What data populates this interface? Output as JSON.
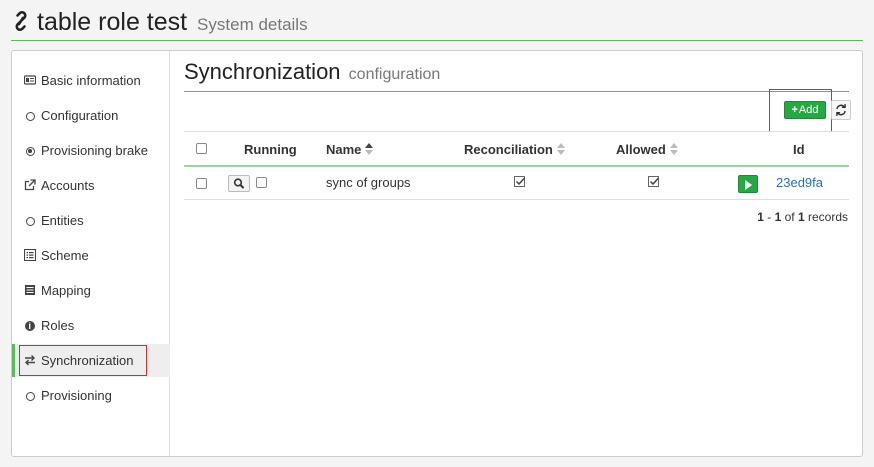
{
  "header": {
    "title": "table role test",
    "subtitle": "System details",
    "icon": "link-icon"
  },
  "sidebar": {
    "items": [
      {
        "label": "Basic information",
        "icon": "id-card-icon"
      },
      {
        "label": "Configuration",
        "icon": "circle-icon"
      },
      {
        "label": "Provisioning brake",
        "icon": "dot-circle-icon"
      },
      {
        "label": "Accounts",
        "icon": "external-link-icon"
      },
      {
        "label": "Entities",
        "icon": "circle-icon"
      },
      {
        "label": "Scheme",
        "icon": "list-alt-icon"
      },
      {
        "label": "Mapping",
        "icon": "list-icon"
      },
      {
        "label": "Roles",
        "icon": "info-icon"
      },
      {
        "label": "Synchronization",
        "icon": "exchange-icon",
        "active": true
      },
      {
        "label": "Provisioning",
        "icon": "circle-icon"
      }
    ]
  },
  "main": {
    "title": "Synchronization",
    "subtitle": "configuration",
    "toolbar": {
      "add_label": "Add",
      "refresh_icon": "refresh-icon"
    },
    "table": {
      "columns": [
        "Running",
        "Name",
        "Reconciliation",
        "Allowed",
        "Id"
      ],
      "sort_column": "Name",
      "sort_direction": "asc",
      "rows": [
        {
          "running": false,
          "name": "sync of groups",
          "reconciliation": true,
          "allowed": true,
          "id": "23ed9fa"
        }
      ]
    },
    "pager": {
      "from": "1",
      "sep1": "-",
      "to": "1",
      "of": "of",
      "total": "1",
      "records": "records"
    }
  },
  "colors": {
    "accent": "#5cb85c",
    "primary_button": "#28a745",
    "highlight_border": "#c9302c",
    "link": "#2a6fb0"
  }
}
